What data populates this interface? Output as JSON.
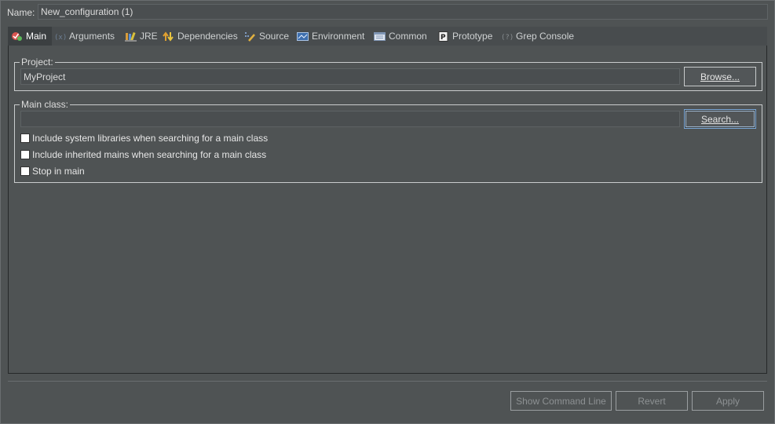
{
  "name_row": {
    "label": "Name:",
    "value": "New_configuration (1)"
  },
  "tabs": [
    {
      "label": "Main",
      "icon": "java-main-icon",
      "active": true
    },
    {
      "label": "Arguments",
      "icon": "arguments-icon",
      "active": false
    },
    {
      "label": "JRE",
      "icon": "jre-library-icon",
      "active": false
    },
    {
      "label": "Dependencies",
      "icon": "dependencies-icon",
      "active": false
    },
    {
      "label": "Source",
      "icon": "source-icon",
      "active": false
    },
    {
      "label": "Environment",
      "icon": "environment-icon",
      "active": false
    },
    {
      "label": "Common",
      "icon": "common-icon",
      "active": false
    },
    {
      "label": "Prototype",
      "icon": "prototype-icon",
      "active": false
    },
    {
      "label": "Grep Console",
      "icon": "grep-console-icon",
      "active": false
    }
  ],
  "project": {
    "legend": "Project:",
    "value": "MyProject",
    "browse_label": "Browse..."
  },
  "main_class": {
    "legend": "Main class:",
    "value": "",
    "search_label": "Search...",
    "options": [
      {
        "label": "Include system libraries when searching for a main class",
        "checked": false
      },
      {
        "label": "Include inherited mains when searching for a main class",
        "checked": false
      },
      {
        "label": "Stop in main",
        "checked": false
      }
    ]
  },
  "footer": {
    "show_command_line": "Show Command Line",
    "revert": "Revert",
    "apply": "Apply"
  },
  "colors": {
    "background": "#4f5354",
    "active_tab": "#3b3f41",
    "focus_border": "#7aa7d6"
  }
}
